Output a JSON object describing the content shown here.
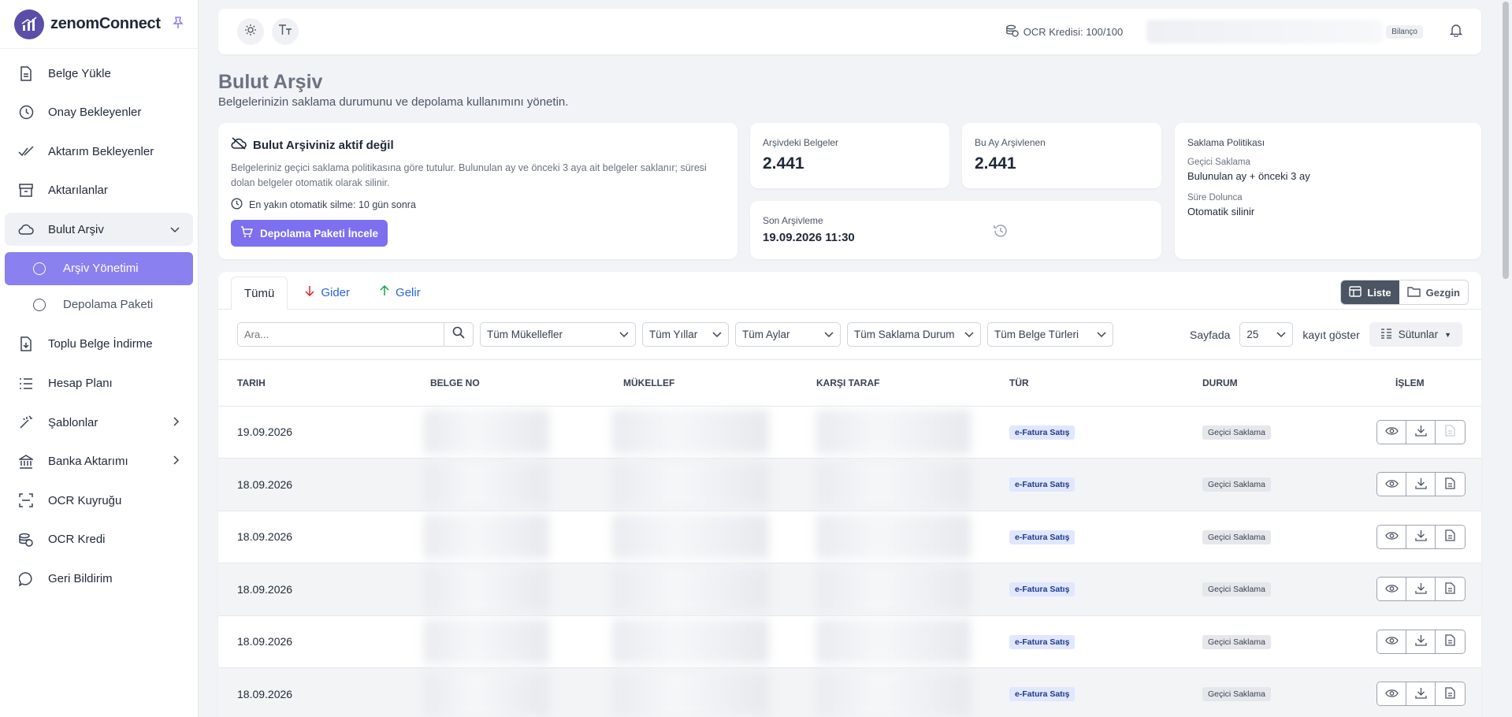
{
  "brand": {
    "name": "zenomConnect"
  },
  "sidebar": {
    "items": [
      {
        "label": "Belge Yükle",
        "icon": "file-icon"
      },
      {
        "label": "Onay Bekleyenler",
        "icon": "clock-icon"
      },
      {
        "label": "Aktarım Bekleyenler",
        "icon": "double-check-icon"
      },
      {
        "label": "Aktarılanlar",
        "icon": "archive-icon"
      },
      {
        "label": "Bulut Arşiv",
        "icon": "cloud-icon"
      },
      {
        "label": "Toplu Belge İndirme",
        "icon": "file-download-icon"
      },
      {
        "label": "Hesap Planı",
        "icon": "list-icon"
      },
      {
        "label": "Şablonlar",
        "icon": "wand-icon"
      },
      {
        "label": "Banka Aktarımı",
        "icon": "bank-icon"
      },
      {
        "label": "OCR Kuyruğu",
        "icon": "scan-icon"
      },
      {
        "label": "OCR Kredi",
        "icon": "coins-icon"
      },
      {
        "label": "Geri Bildirim",
        "icon": "message-icon"
      }
    ],
    "sub_items": [
      {
        "label": "Arşiv Yönetimi",
        "active": true
      },
      {
        "label": "Depolama Paketi",
        "active": false
      }
    ]
  },
  "header": {
    "ocr_credit": "OCR Kredisi: 100/100",
    "company_badge": "Bilanço"
  },
  "page": {
    "title": "Bulut Arşiv",
    "subtitle": "Belgelerinizin saklama durumunu ve depolama kullanımını yönetin."
  },
  "archive_card": {
    "title": "Bulut Arşiviniz aktif değil",
    "description": "Belgeleriniz geçici saklama politikasına göre tutulur. Bulunulan ay ve önceki 3 aya ait belgeler saklanır; süresi dolan belgeler otomatik olarak silinir.",
    "next_delete": "En yakın otomatik silme: 10 gün sonra",
    "button": "Depolama Paketi İncele"
  },
  "stats": {
    "archived_label": "Arşivdeki Belgeler",
    "archived_value": "2.441",
    "month_label": "Bu Ay Arşivlenen",
    "month_value": "2.441",
    "last_label": "Son Arşivleme",
    "last_value": "19.09.2026 11:30"
  },
  "policy": {
    "title": "Saklama Politikası",
    "k1": "Geçici Saklama",
    "v1": "Bulunulan ay + önceki 3 ay",
    "k2": "Süre Dolunca",
    "v2": "Otomatik silinir"
  },
  "tabs": {
    "all": "Tümü",
    "expense": "Gider",
    "income": "Gelir"
  },
  "view": {
    "list": "Liste",
    "explorer": "Gezgin"
  },
  "filters": {
    "search_placeholder": "Ara...",
    "taxpayers": "Tüm Mükellefler",
    "years": "Tüm Yıllar",
    "months": "Tüm Aylar",
    "retention": "Tüm Saklama Durum",
    "doc_types": "Tüm Belge Türleri",
    "page_label": "Sayfada",
    "page_size": "25",
    "show_label": "kayıt göster",
    "columns": "Sütunlar"
  },
  "table": {
    "headers": [
      "Tarih",
      "Belge No",
      "Mükellef",
      "Karşı Taraf",
      "Tür",
      "Durum",
      "İşlem"
    ],
    "rows": [
      {
        "date": "19.09.2026",
        "type": "e-Fatura Satış",
        "status": "Geçici Saklama"
      },
      {
        "date": "18.09.2026",
        "type": "e-Fatura Satış",
        "status": "Geçici Saklama"
      },
      {
        "date": "18.09.2026",
        "type": "e-Fatura Satış",
        "status": "Geçici Saklama"
      },
      {
        "date": "18.09.2026",
        "type": "e-Fatura Satış",
        "status": "Geçici Saklama"
      },
      {
        "date": "18.09.2026",
        "type": "e-Fatura Satış",
        "status": "Geçici Saklama"
      },
      {
        "date": "18.09.2026",
        "type": "e-Fatura Satış",
        "status": "Geçici Saklama"
      }
    ]
  },
  "colors": {
    "accent": "#7c6ff0",
    "active_nav": "#8b80f0",
    "link": "#2563eb"
  }
}
